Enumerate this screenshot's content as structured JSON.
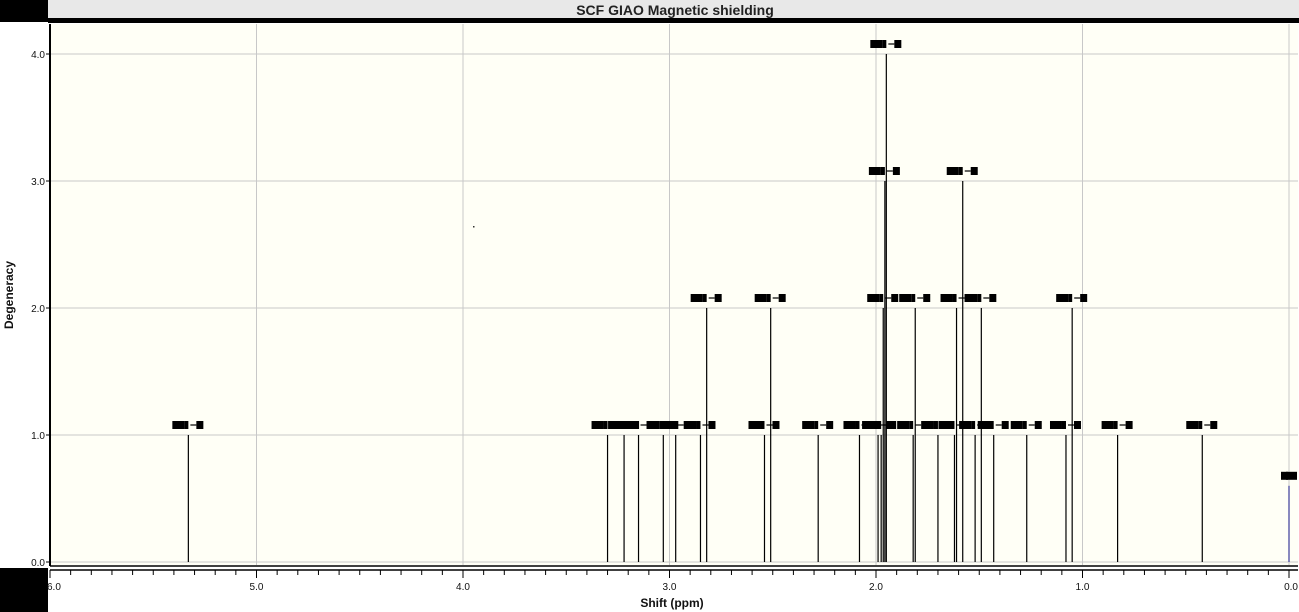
{
  "window": {
    "title": "SCF GIAO Magnetic shielding"
  },
  "colors": {
    "plot_background": "#fffff6",
    "grid": "#c8c8c8",
    "frame": "#000000",
    "title_bar": "#e8e8e8",
    "stick": "#000000",
    "tms_stick": "#3a3a9a"
  },
  "chart_data": {
    "type": "bar",
    "subtype": "stick-spectrum",
    "title": "SCF GIAO Magnetic shielding",
    "xlabel": "Shift (ppm)",
    "ylabel": "Degeneracy",
    "xlim": [
      6.0,
      0.0
    ],
    "x_reversed": true,
    "ylim": [
      0.0,
      4.2
    ],
    "xticks": [
      6.0,
      5.0,
      4.0,
      3.0,
      2.0,
      1.0,
      0.0
    ],
    "xtick_labels": [
      "6.0",
      "5.0",
      "4.0",
      "3.0",
      "2.0",
      "1.0",
      "0.0"
    ],
    "yticks": [
      0.0,
      1.0,
      2.0,
      3.0,
      4.0
    ],
    "ytick_labels": [
      "0.0",
      "1.0",
      "2.0",
      "3.0",
      "4.0"
    ],
    "grid": true,
    "peak_labels_shown": true,
    "peaks": [
      {
        "shift": 5.33,
        "degeneracy": 1
      },
      {
        "shift": 3.3,
        "degeneracy": 1
      },
      {
        "shift": 3.22,
        "degeneracy": 1
      },
      {
        "shift": 3.15,
        "degeneracy": 1
      },
      {
        "shift": 3.03,
        "degeneracy": 1
      },
      {
        "shift": 2.97,
        "degeneracy": 1
      },
      {
        "shift": 2.85,
        "degeneracy": 1
      },
      {
        "shift": 2.82,
        "degeneracy": 2
      },
      {
        "shift": 2.54,
        "degeneracy": 1
      },
      {
        "shift": 2.51,
        "degeneracy": 2
      },
      {
        "shift": 2.28,
        "degeneracy": 1
      },
      {
        "shift": 2.08,
        "degeneracy": 1
      },
      {
        "shift": 1.99,
        "degeneracy": 1
      },
      {
        "shift": 1.975,
        "degeneracy": 1
      },
      {
        "shift": 1.965,
        "degeneracy": 2
      },
      {
        "shift": 1.957,
        "degeneracy": 3
      },
      {
        "shift": 1.95,
        "degeneracy": 4
      },
      {
        "shift": 1.82,
        "degeneracy": 1
      },
      {
        "shift": 1.81,
        "degeneracy": 2
      },
      {
        "shift": 1.7,
        "degeneracy": 1
      },
      {
        "shift": 1.62,
        "degeneracy": 1
      },
      {
        "shift": 1.61,
        "degeneracy": 2
      },
      {
        "shift": 1.58,
        "degeneracy": 3
      },
      {
        "shift": 1.52,
        "degeneracy": 1
      },
      {
        "shift": 1.49,
        "degeneracy": 2
      },
      {
        "shift": 1.43,
        "degeneracy": 1
      },
      {
        "shift": 1.27,
        "degeneracy": 1
      },
      {
        "shift": 1.08,
        "degeneracy": 1
      },
      {
        "shift": 1.05,
        "degeneracy": 2
      },
      {
        "shift": 0.83,
        "degeneracy": 1
      },
      {
        "shift": 0.42,
        "degeneracy": 1
      },
      {
        "shift": 0.0,
        "degeneracy": 0.6,
        "reference": true
      }
    ]
  }
}
